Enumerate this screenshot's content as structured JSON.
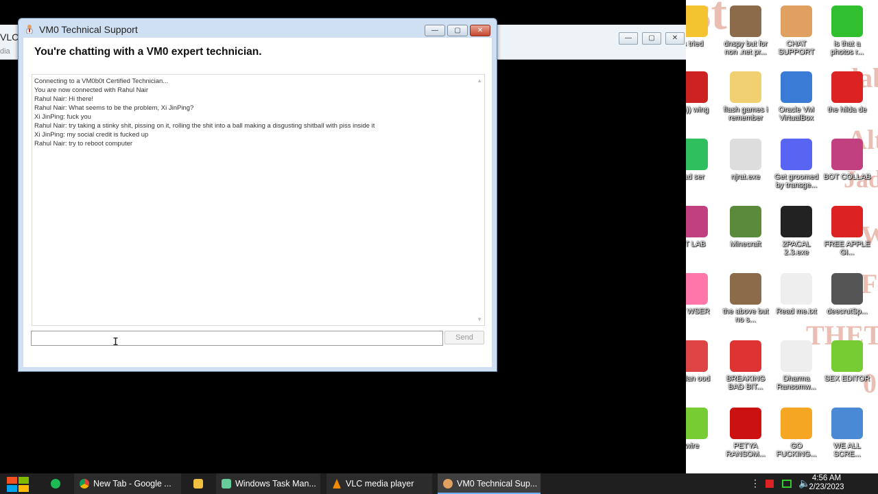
{
  "desktop": {
    "watermark_lines": [
      "IO Test",
      "daba",
      "Alt",
      "Jade",
      "W",
      "F",
      "THETA",
      "0"
    ],
    "icons": [
      {
        "label": "is tried",
        "icon": "star-icon",
        "color": "#f4c430"
      },
      {
        "label": "dnspy but for non .net pr...",
        "icon": "portrait-icon",
        "color": "#8b6b4a"
      },
      {
        "label": "CHAT SUPPORT",
        "icon": "support-agent-icon",
        "color": "#e0a060"
      },
      {
        "label": "is that a photos r...",
        "icon": "whatsapp-icon",
        "color": "#2fbf2f"
      },
      {
        "label": "ey))) wing",
        "icon": "santa-icon",
        "color": "#c22"
      },
      {
        "label": "flash games i remember",
        "icon": "folder-icon",
        "color": "#f0d070"
      },
      {
        "label": "Oracle VM VirtualBox",
        "icon": "virtualbox-icon",
        "color": "#3a7bd5"
      },
      {
        "label": "the hilda de",
        "icon": "devcpp-icon",
        "color": "#d22"
      },
      {
        "label": "sad ser",
        "icon": "app-icon",
        "color": "#2fbf5f"
      },
      {
        "label": "njrat.exe",
        "icon": "skull-icon",
        "color": "#ddd"
      },
      {
        "label": "Get groomed by transge...",
        "icon": "discord-icon",
        "color": "#5865f2"
      },
      {
        "label": "BOT COLLAB",
        "icon": "monitor-icon",
        "color": "#c04080"
      },
      {
        "label": "OT LAB",
        "icon": "monitor-icon",
        "color": "#c04080"
      },
      {
        "label": "Minecraft",
        "icon": "minecraft-icon",
        "color": "#5a8a3a"
      },
      {
        "label": "2PACAL 2.3.exe",
        "icon": "cmd-icon",
        "color": "#222"
      },
      {
        "label": "FREE APPLE GI...",
        "icon": "apple-icon",
        "color": "#d22"
      },
      {
        "label": "CP WSER",
        "icon": "browser-icon",
        "color": "#f7a"
      },
      {
        "label": "the above but no s...",
        "icon": "portrait-icon",
        "color": "#8b6b4a"
      },
      {
        "label": "Read me.txt",
        "icon": "text-file-icon",
        "color": "#eee"
      },
      {
        "label": "deecrutSp...",
        "icon": "windows-stack-icon",
        "color": "#555"
      },
      {
        "label": "andan ood",
        "icon": "cartoon-icon",
        "color": "#d44"
      },
      {
        "label": "BREAKING BAD BIT...",
        "icon": "angry-bird-icon",
        "color": "#d33"
      },
      {
        "label": "Dharma Ransomw...",
        "icon": "skull-icon",
        "color": "#eee"
      },
      {
        "label": "SEX EDITOR",
        "icon": "hxd-icon",
        "color": "#7c3"
      },
      {
        "label": "wire",
        "icon": "lime-icon",
        "color": "#7c3"
      },
      {
        "label": "PETYA RANSOM...",
        "icon": "petya-icon",
        "color": "#c11"
      },
      {
        "label": "GO FUCKING...",
        "icon": "de-icon",
        "color": "#f5a623"
      },
      {
        "label": "WE ALL SCRE...",
        "icon": "computer-icon",
        "color": "#4a8ad4"
      }
    ]
  },
  "vlc_window": {
    "title": "VLC",
    "menu_fragment": "dia"
  },
  "chat_window": {
    "title": "VM0 Technical Support",
    "heading": "You're chatting with a VM0 expert technician.",
    "messages": [
      "Connecting to a VM0b0t Certified Technician...",
      "You are now connected with Rahul Nair",
      "Rahul Nair: Hi there!",
      "Rahul Nair: What seems to be the problem, Xi JinPing?",
      "Xi JinPing: fuck you",
      "Rahul Nair: try taking a stinky shit, pissing on it, rolling the shit into a ball making a disgusting shitball with piss inside it",
      "Xi JinPing: my social credit  is fucked up",
      "Rahul Nair: try to reboot computer"
    ],
    "input_value": "",
    "send_label": "Send"
  },
  "taskbar": {
    "items": [
      {
        "label": "",
        "icon": "chat-bubble-icon",
        "color": "#1db954"
      },
      {
        "label": "New Tab - Google ...",
        "icon": "chrome-icon",
        "color": "#4285f4"
      },
      {
        "label": "",
        "icon": "file-explorer-icon",
        "color": "#f0c040"
      },
      {
        "label": "Windows Task Man...",
        "icon": "task-manager-icon",
        "color": "#6c9"
      },
      {
        "label": "VLC media player",
        "icon": "vlc-icon",
        "color": "#f08a00"
      },
      {
        "label": "VM0 Technical Sup...",
        "icon": "support-agent-icon",
        "color": "#e0a060"
      }
    ],
    "time": "4:56 AM",
    "date": "2/23/2023"
  }
}
